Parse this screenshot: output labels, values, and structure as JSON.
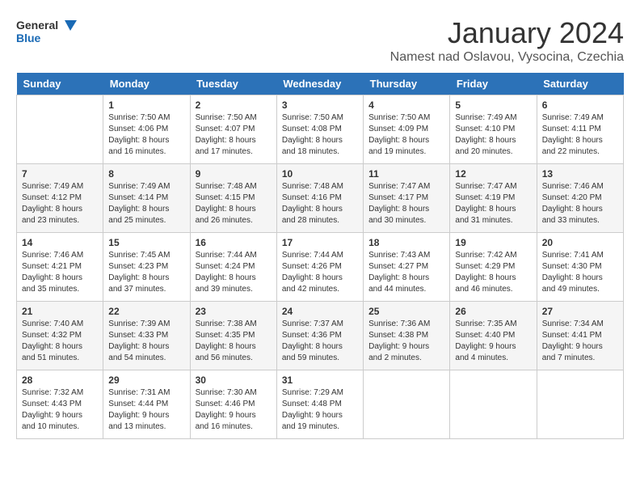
{
  "header": {
    "logo_line1": "General",
    "logo_line2": "Blue",
    "month": "January 2024",
    "location": "Namest nad Oslavou, Vysocina, Czechia"
  },
  "weekdays": [
    "Sunday",
    "Monday",
    "Tuesday",
    "Wednesday",
    "Thursday",
    "Friday",
    "Saturday"
  ],
  "weeks": [
    [
      {
        "day": "",
        "info": ""
      },
      {
        "day": "1",
        "info": "Sunrise: 7:50 AM\nSunset: 4:06 PM\nDaylight: 8 hours\nand 16 minutes."
      },
      {
        "day": "2",
        "info": "Sunrise: 7:50 AM\nSunset: 4:07 PM\nDaylight: 8 hours\nand 17 minutes."
      },
      {
        "day": "3",
        "info": "Sunrise: 7:50 AM\nSunset: 4:08 PM\nDaylight: 8 hours\nand 18 minutes."
      },
      {
        "day": "4",
        "info": "Sunrise: 7:50 AM\nSunset: 4:09 PM\nDaylight: 8 hours\nand 19 minutes."
      },
      {
        "day": "5",
        "info": "Sunrise: 7:49 AM\nSunset: 4:10 PM\nDaylight: 8 hours\nand 20 minutes."
      },
      {
        "day": "6",
        "info": "Sunrise: 7:49 AM\nSunset: 4:11 PM\nDaylight: 8 hours\nand 22 minutes."
      }
    ],
    [
      {
        "day": "7",
        "info": "Sunrise: 7:49 AM\nSunset: 4:12 PM\nDaylight: 8 hours\nand 23 minutes."
      },
      {
        "day": "8",
        "info": "Sunrise: 7:49 AM\nSunset: 4:14 PM\nDaylight: 8 hours\nand 25 minutes."
      },
      {
        "day": "9",
        "info": "Sunrise: 7:48 AM\nSunset: 4:15 PM\nDaylight: 8 hours\nand 26 minutes."
      },
      {
        "day": "10",
        "info": "Sunrise: 7:48 AM\nSunset: 4:16 PM\nDaylight: 8 hours\nand 28 minutes."
      },
      {
        "day": "11",
        "info": "Sunrise: 7:47 AM\nSunset: 4:17 PM\nDaylight: 8 hours\nand 30 minutes."
      },
      {
        "day": "12",
        "info": "Sunrise: 7:47 AM\nSunset: 4:19 PM\nDaylight: 8 hours\nand 31 minutes."
      },
      {
        "day": "13",
        "info": "Sunrise: 7:46 AM\nSunset: 4:20 PM\nDaylight: 8 hours\nand 33 minutes."
      }
    ],
    [
      {
        "day": "14",
        "info": "Sunrise: 7:46 AM\nSunset: 4:21 PM\nDaylight: 8 hours\nand 35 minutes."
      },
      {
        "day": "15",
        "info": "Sunrise: 7:45 AM\nSunset: 4:23 PM\nDaylight: 8 hours\nand 37 minutes."
      },
      {
        "day": "16",
        "info": "Sunrise: 7:44 AM\nSunset: 4:24 PM\nDaylight: 8 hours\nand 39 minutes."
      },
      {
        "day": "17",
        "info": "Sunrise: 7:44 AM\nSunset: 4:26 PM\nDaylight: 8 hours\nand 42 minutes."
      },
      {
        "day": "18",
        "info": "Sunrise: 7:43 AM\nSunset: 4:27 PM\nDaylight: 8 hours\nand 44 minutes."
      },
      {
        "day": "19",
        "info": "Sunrise: 7:42 AM\nSunset: 4:29 PM\nDaylight: 8 hours\nand 46 minutes."
      },
      {
        "day": "20",
        "info": "Sunrise: 7:41 AM\nSunset: 4:30 PM\nDaylight: 8 hours\nand 49 minutes."
      }
    ],
    [
      {
        "day": "21",
        "info": "Sunrise: 7:40 AM\nSunset: 4:32 PM\nDaylight: 8 hours\nand 51 minutes."
      },
      {
        "day": "22",
        "info": "Sunrise: 7:39 AM\nSunset: 4:33 PM\nDaylight: 8 hours\nand 54 minutes."
      },
      {
        "day": "23",
        "info": "Sunrise: 7:38 AM\nSunset: 4:35 PM\nDaylight: 8 hours\nand 56 minutes."
      },
      {
        "day": "24",
        "info": "Sunrise: 7:37 AM\nSunset: 4:36 PM\nDaylight: 8 hours\nand 59 minutes."
      },
      {
        "day": "25",
        "info": "Sunrise: 7:36 AM\nSunset: 4:38 PM\nDaylight: 9 hours\nand 2 minutes."
      },
      {
        "day": "26",
        "info": "Sunrise: 7:35 AM\nSunset: 4:40 PM\nDaylight: 9 hours\nand 4 minutes."
      },
      {
        "day": "27",
        "info": "Sunrise: 7:34 AM\nSunset: 4:41 PM\nDaylight: 9 hours\nand 7 minutes."
      }
    ],
    [
      {
        "day": "28",
        "info": "Sunrise: 7:32 AM\nSunset: 4:43 PM\nDaylight: 9 hours\nand 10 minutes."
      },
      {
        "day": "29",
        "info": "Sunrise: 7:31 AM\nSunset: 4:44 PM\nDaylight: 9 hours\nand 13 minutes."
      },
      {
        "day": "30",
        "info": "Sunrise: 7:30 AM\nSunset: 4:46 PM\nDaylight: 9 hours\nand 16 minutes."
      },
      {
        "day": "31",
        "info": "Sunrise: 7:29 AM\nSunset: 4:48 PM\nDaylight: 9 hours\nand 19 minutes."
      },
      {
        "day": "",
        "info": ""
      },
      {
        "day": "",
        "info": ""
      },
      {
        "day": "",
        "info": ""
      }
    ]
  ]
}
